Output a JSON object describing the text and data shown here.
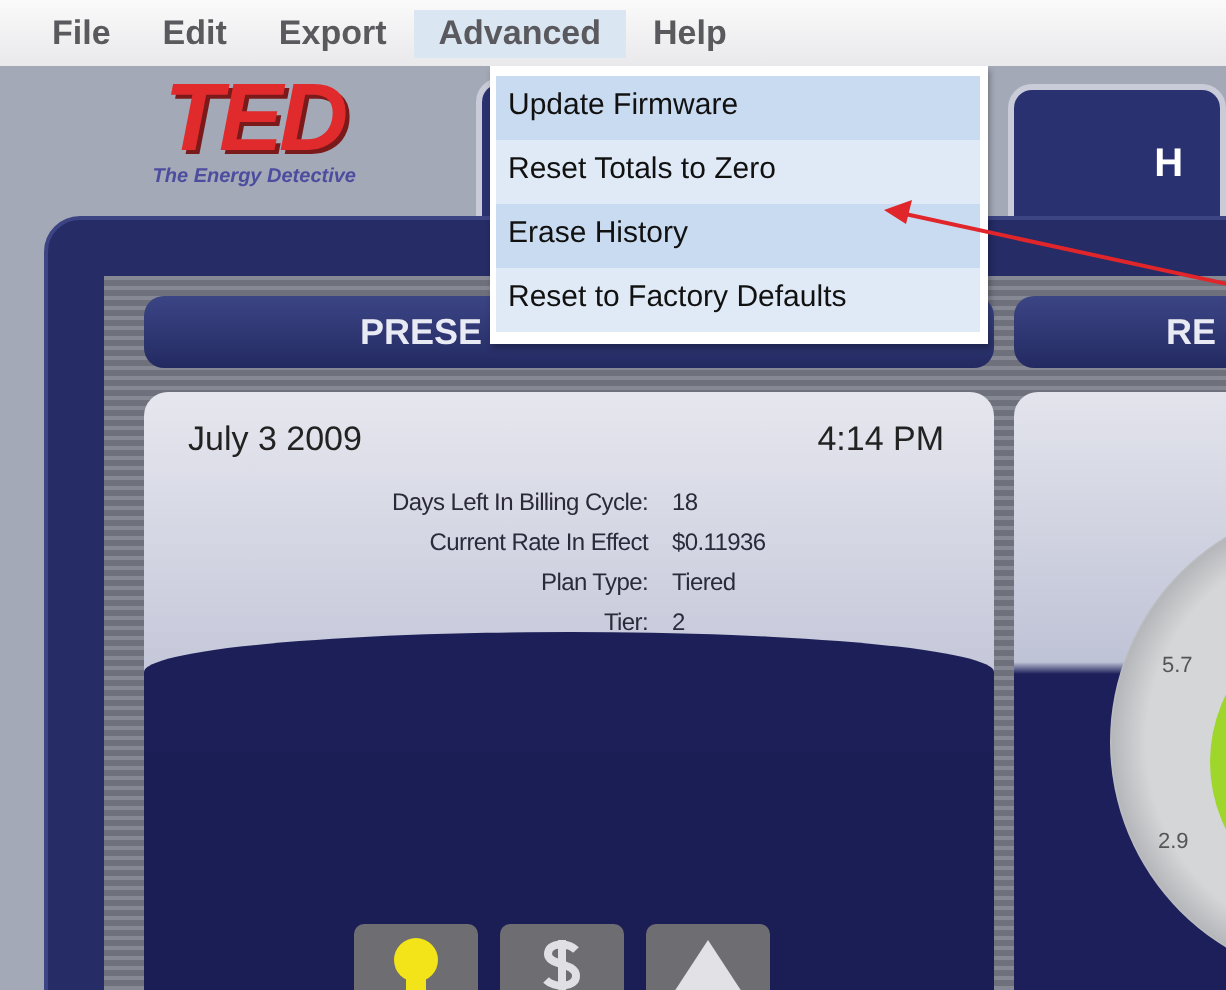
{
  "menu_bar": [
    {
      "label": "File",
      "selected": false
    },
    {
      "label": "Edit",
      "selected": false
    },
    {
      "label": "Export",
      "selected": false
    },
    {
      "label": "Advanced",
      "selected": true
    },
    {
      "label": "Help",
      "selected": false
    }
  ],
  "dropdown": {
    "items": [
      "Update Firmware",
      "Reset Totals to Zero",
      "Erase History",
      "Reset to Factory Defaults"
    ]
  },
  "logo": {
    "name": "TED",
    "tagline": "The Energy Detective"
  },
  "tabs": [
    {
      "label": "H"
    }
  ],
  "panels": [
    {
      "header": "PRESE"
    },
    {
      "header": "RE"
    }
  ],
  "present": {
    "date": "July 3 2009",
    "time": "4:14 PM",
    "details": [
      {
        "label": "Days Left In Billing Cycle:",
        "value": "18"
      },
      {
        "label": "Current Rate In Effect",
        "value": "$0.11936"
      },
      {
        "label": "Plan Type:",
        "value": "Tiered"
      },
      {
        "label": "Tier:",
        "value": "2"
      }
    ],
    "buttons": [
      {
        "kind": "kw"
      },
      {
        "kind": "dollar"
      },
      {
        "kind": "co2"
      }
    ]
  },
  "gauge": {
    "ticks": [
      "5.7",
      "2.9"
    ]
  }
}
